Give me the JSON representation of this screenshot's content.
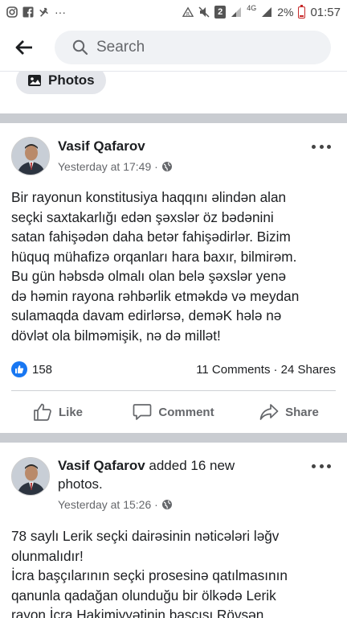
{
  "status_bar": {
    "left_icons": [
      "instagram-icon",
      "facebook-icon",
      "missed-call-icon",
      "more-dots-icon"
    ],
    "battery_percent": "2%",
    "time": "01:57",
    "sim_label": "2",
    "network_label": "4G"
  },
  "header": {
    "search_placeholder": "Search"
  },
  "chip": {
    "label": "Photos"
  },
  "posts": [
    {
      "author": "Vasif Qafarov",
      "action": "",
      "timestamp": "Yesterday at 17:49 ·",
      "text": "Bir rayonun konstitusiya haqqını əlindən alan\nseçki saxtakarlığı edən şəxslər öz bədənini\nsatan fahişədən daha betər fahişədirlər. Bizim\nhüquq mühafizə orqanları hara baxır, bilmirəm.\nBu gün həbsdə olmalı olan belə şəxslər yenə\ndə həmin rayona rəhbərlik etməkdə və meydan\nsulamaqda  davam edirlərsə, deməK hələ nə\ndövlət ola bilməmişik, nə də millət!",
      "reactions": "158",
      "comments": "11 Comments",
      "shares": "· 24 Shares",
      "actions": {
        "like": "Like",
        "comment": "Comment",
        "share": "Share"
      }
    },
    {
      "author": "Vasif Qafarov",
      "action": " added 16 new photos.",
      "timestamp": "Yesterday at 15:26 ·",
      "text": "78 saylı Lerik seçki dairəsinin nəticələri ləğv\nolunmalıdır!\nİcra başçılarının seçki prosesinə qatılmasının\nqanunla qadağan olunduğu bir ölkədə Lerik\nrayon İcra Hakimiyyətinin başçısı Rövşən"
    }
  ],
  "colors": {
    "accent": "#1877f2",
    "divider": "#c9ccd1",
    "secondary_text": "#65676b"
  }
}
